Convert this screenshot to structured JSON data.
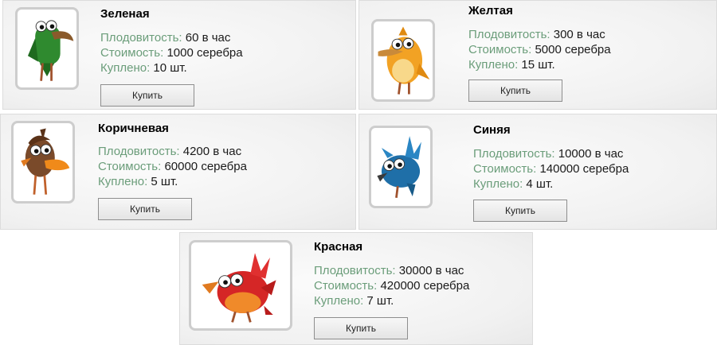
{
  "labels": {
    "productivity": "Плодовитость:",
    "cost": "Стоимость:",
    "bought": "Куплено:"
  },
  "birds": [
    {
      "name": "Зеленая",
      "productivity": "60 в час",
      "cost": "1000 серебра",
      "bought": "10 шт.",
      "button": "Купить",
      "color": "#2f8a2f",
      "icon": "green-bird-icon"
    },
    {
      "name": "Желтая",
      "productivity": "300 в час",
      "cost": "5000 серебра",
      "bought": "15 шт.",
      "button": "Купить",
      "color": "#f2a224",
      "icon": "yellow-bird-icon"
    },
    {
      "name": "Коричневая",
      "productivity": "4200 в час",
      "cost": "60000 серебра",
      "bought": "5 шт.",
      "button": "Купить",
      "color": "#7a4a2a",
      "icon": "brown-bird-icon"
    },
    {
      "name": "Синяя",
      "productivity": "10000 в час",
      "cost": "140000 серебра",
      "bought": "4 шт.",
      "button": "Купить",
      "color": "#1f6fa8",
      "icon": "blue-bird-icon"
    },
    {
      "name": "Красная",
      "productivity": "30000 в час",
      "cost": "420000 серебра",
      "bought": "7 шт.",
      "button": "Купить",
      "color": "#d52626",
      "icon": "red-bird-icon"
    }
  ]
}
